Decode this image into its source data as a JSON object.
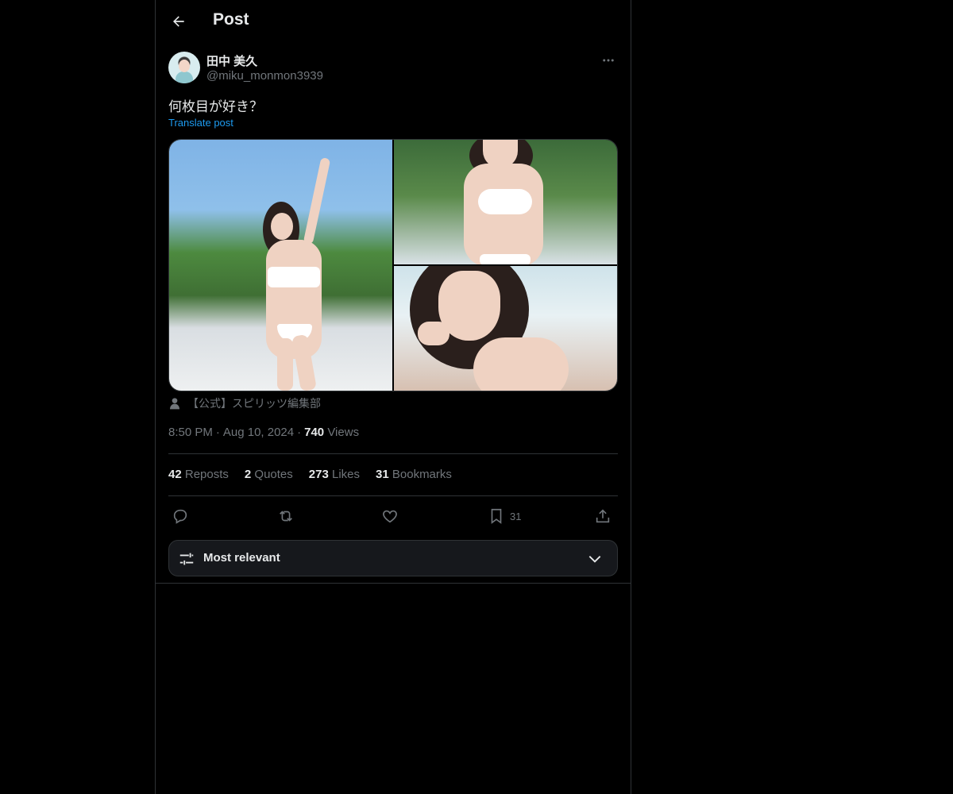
{
  "header": {
    "title": "Post"
  },
  "post": {
    "author_name": "田中 美久",
    "author_handle": "@miku_monmon3939",
    "text": "何枚目が好き？",
    "translate_label": "Translate post",
    "media_credit": "【公式】スピリッツ編集部",
    "time": "8:50 PM",
    "date": "Aug 10, 2024",
    "views_count": "740",
    "views_label": "Views"
  },
  "stats": {
    "reposts_count": "42",
    "reposts_label": "Reposts",
    "quotes_count": "2",
    "quotes_label": "Quotes",
    "likes_count": "273",
    "likes_label": "Likes",
    "bookmarks_count": "31",
    "bookmarks_label": "Bookmarks"
  },
  "actions": {
    "bookmark_count": "31"
  },
  "sort": {
    "label": "Most relevant"
  },
  "icons": [
    "back-arrow-icon",
    "more-icon",
    "person-icon",
    "reply-icon",
    "repost-icon",
    "like-icon",
    "bookmark-icon",
    "share-icon",
    "sliders-icon",
    "chevron-down-icon"
  ],
  "colors": {
    "accent": "#1d9bf0",
    "background": "#000000",
    "secondary_text": "#71767b",
    "border": "#2f3336"
  }
}
